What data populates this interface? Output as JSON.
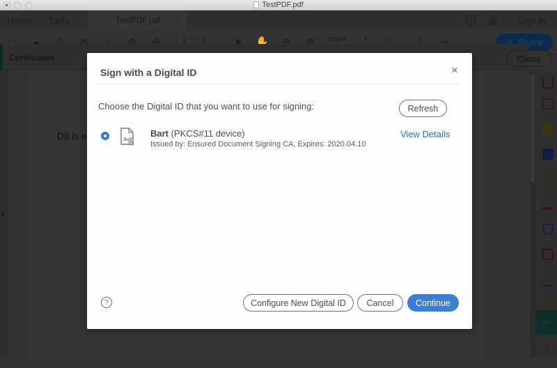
{
  "window": {
    "title": "TestPDF.pdf"
  },
  "topnav": {
    "home": "Home",
    "tools": "Tools",
    "doc_tab": "TestPDF.pdf",
    "doc_tab_close": "×",
    "help": "?",
    "sign_in": "Sign In"
  },
  "toolbar": {
    "page_current": "1",
    "page_total": "/ 1",
    "zoom_level": "104%",
    "share_label": "Share",
    "more": "•••"
  },
  "certbar": {
    "label": "Certificates",
    "close_label": "Close"
  },
  "document": {
    "visible_text": "Dit is e"
  },
  "dialog": {
    "title": "Sign with a Digital ID",
    "close": "×",
    "prompt": "Choose the Digital ID that you want to use for signing:",
    "refresh_label": "Refresh",
    "digital_ids": [
      {
        "name": "Bart",
        "type": "(PKCS#11 device)",
        "issuer_line": "Issued by: Ensured Document Signing CA, Expires: 2020.04.10",
        "selected": true,
        "view_details_label": "View Details"
      }
    ],
    "help": "?",
    "configure_label": "Configure New Digital ID",
    "cancel_label": "Cancel",
    "continue_label": "Continue"
  },
  "colors": {
    "primary_blue": "#3a7fd5",
    "link_blue": "#2e6cc0",
    "radio_blue": "#2f7be0"
  }
}
